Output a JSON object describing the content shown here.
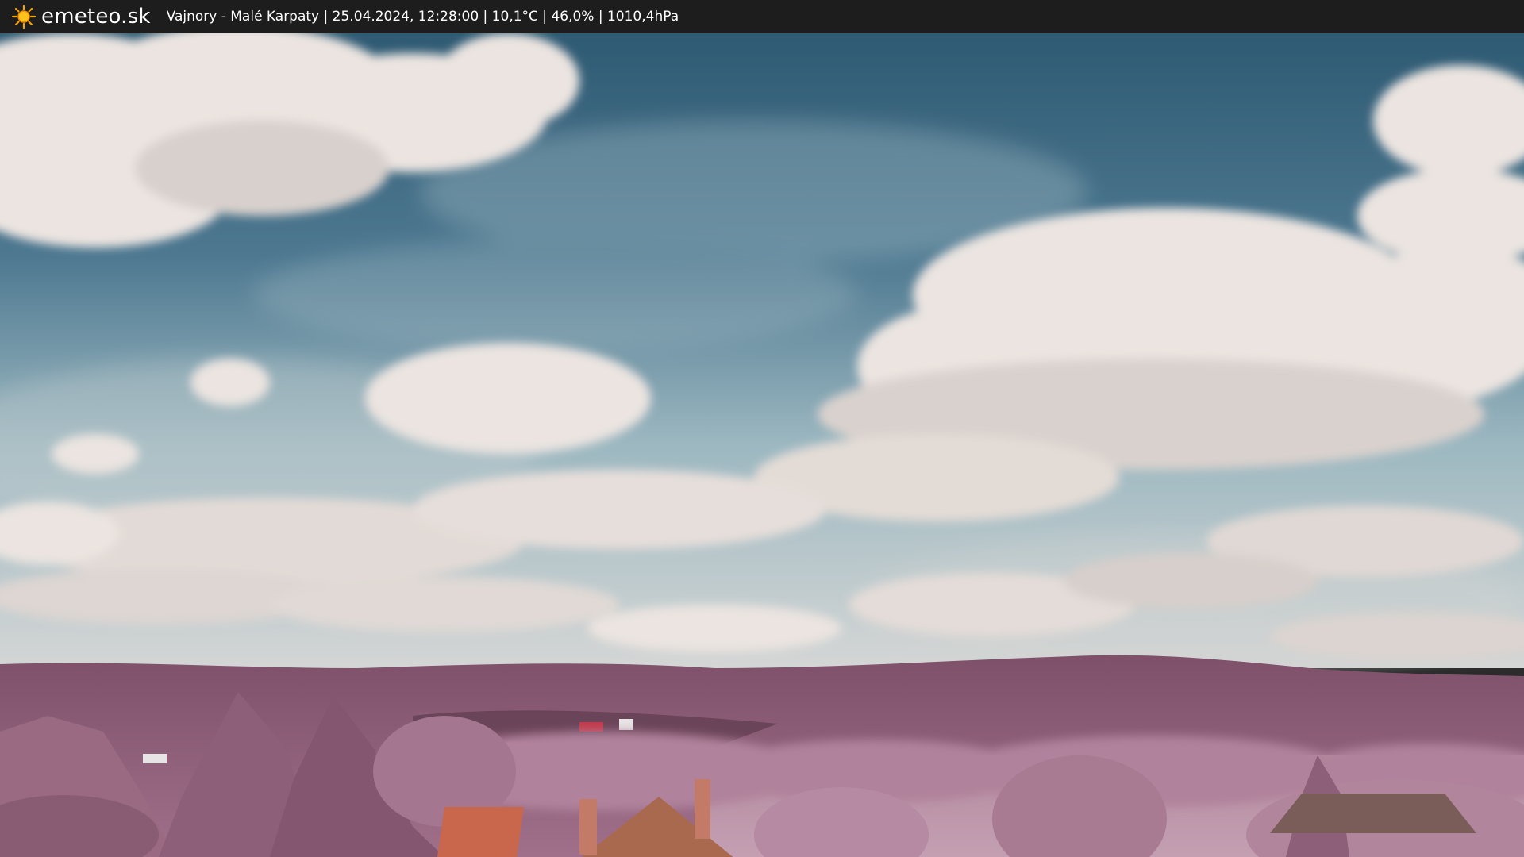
{
  "header": {
    "logo_icon": "sun-icon",
    "brand": "emeteo.sk",
    "caption": "Vajnory - Malé Karpaty | 25.04.2024, 12:28:00 | 10,1°C | 46,0% | 1010,4hPa"
  },
  "colors": {
    "topbar": "#1d1d1d",
    "sky_top": "#2d5670",
    "sky_bottom": "#8fb0bc",
    "cloud": "#ece6e2",
    "hills": "#8c5d78",
    "foliage": "#b98aa4",
    "roof": "#c9674c"
  }
}
